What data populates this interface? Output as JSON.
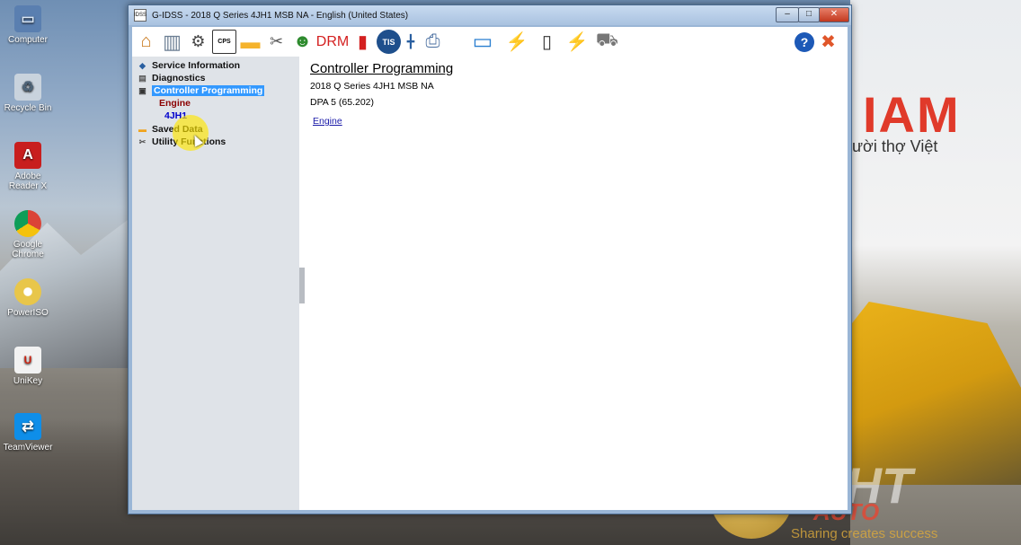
{
  "desktop": {
    "icons": [
      {
        "label": "Computer",
        "icon": "computer-icon"
      },
      {
        "label": "Recycle Bin",
        "icon": "recycle-bin-icon"
      },
      {
        "label": "Adobe Reader X",
        "icon": "adobe-reader-icon"
      },
      {
        "label": "Google Chrome",
        "icon": "chrome-icon"
      },
      {
        "label": "PowerISO",
        "icon": "poweriso-icon"
      },
      {
        "label": "UniKey",
        "icon": "unikey-icon"
      },
      {
        "label": "TeamViewer",
        "icon": "teamviewer-icon"
      }
    ],
    "wallpaper_brand": "IAM",
    "wallpaper_sub": "ười thợ Việt",
    "watermark": {
      "text": "DHT",
      "sub": "AUTO",
      "tagline": "Sharing creates success"
    }
  },
  "window": {
    "title": "G-IDSS - 2018 Q Series 4JH1 MSB NA - English (United States)",
    "app_badge": "IDSS",
    "controls": {
      "minimize": "–",
      "maximize": "□",
      "close": "✕"
    }
  },
  "toolbar": {
    "buttons": [
      {
        "icon": "home-icon",
        "glyph": "⌂"
      },
      {
        "icon": "book-icon",
        "glyph": "▥"
      },
      {
        "icon": "diagnostic-tool-icon",
        "glyph": "⚙"
      },
      {
        "icon": "cps-icon",
        "glyph": "CPS"
      },
      {
        "icon": "folder-icon",
        "glyph": "▬"
      },
      {
        "icon": "wrench-icon",
        "glyph": "✂"
      },
      {
        "icon": "frog-icon",
        "glyph": "☻"
      },
      {
        "icon": "drm-icon",
        "glyph": "DRM"
      },
      {
        "icon": "bar-chart-icon",
        "glyph": "▮"
      },
      {
        "icon": "tis-icon",
        "glyph": "TIS"
      },
      {
        "icon": "pin-icon",
        "glyph": "╋"
      },
      {
        "icon": "printer-icon",
        "glyph": "⎙"
      },
      {
        "icon": "laptop-icon",
        "glyph": "▭"
      },
      {
        "icon": "flash-icon",
        "glyph": "⚡"
      },
      {
        "icon": "device-icon",
        "glyph": "▯"
      },
      {
        "icon": "flash-disabled-icon",
        "glyph": "⚡"
      },
      {
        "icon": "truck-icon",
        "glyph": "⛟"
      }
    ],
    "help_glyph": "?",
    "exit_glyph": "✖"
  },
  "tree": {
    "items": [
      {
        "label": "Service Information",
        "icon": "service-info-icon"
      },
      {
        "label": "Diagnostics",
        "icon": "diagnostics-icon"
      },
      {
        "label": "Controller Programming",
        "icon": "controller-programming-icon",
        "selected": true
      },
      {
        "label": "Engine"
      },
      {
        "label": "4JH1"
      },
      {
        "label": "Saved Data",
        "icon": "saved-data-icon"
      },
      {
        "label": "Utility Functions",
        "icon": "utility-functions-icon"
      }
    ]
  },
  "main": {
    "heading": "Controller Programming",
    "vehicle": "2018 Q Series 4JH1 MSB NA",
    "dpa": "DPA 5 (65.202)",
    "link": "Engine"
  },
  "colors": {
    "tree_selected_bg": "#3399ff",
    "engine_label": "#8b0000",
    "model_label": "#0000cc",
    "drm_red": "#d42020",
    "tis_blue": "#1e4f8c"
  }
}
